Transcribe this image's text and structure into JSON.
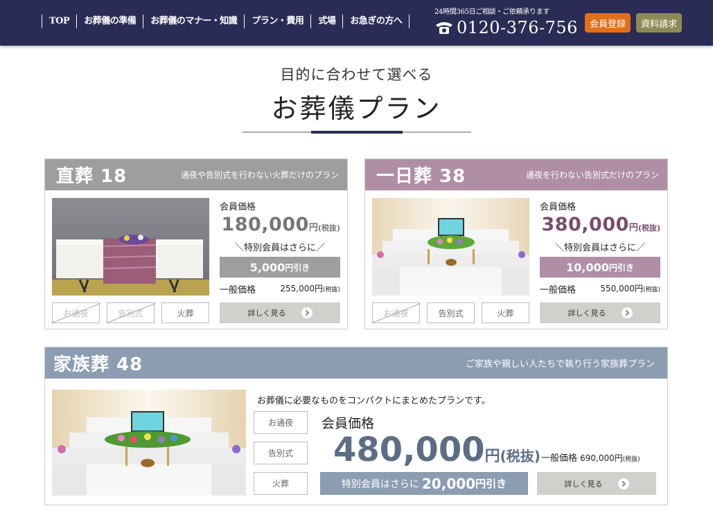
{
  "header": {
    "nav": [
      "TOP",
      "お葬儀の準備",
      "お葬儀のマナー・知識",
      "プラン・費用",
      "式場",
      "お急ぎの方へ"
    ],
    "contact_note": "24時間365日ご相談・ご依頼承ります",
    "phone": "0120-376-756",
    "member_button": "会員登録",
    "request_button": "資料請求"
  },
  "section": {
    "subtitle": "目的に合わせて選べる",
    "title": "お葬儀プラン"
  },
  "plans": [
    {
      "name": "直葬 18",
      "desc": "通夜や告別式を行わない火葬だけのプラン",
      "member_label": "会員価格",
      "price": "180,000",
      "unit": "円",
      "tax": "(税抜)",
      "special": "＼特別会員はさらに／",
      "discount": "5,000",
      "discount_suffix": "円引き",
      "general_label": "一般価格",
      "general_price": "255,000円",
      "general_tax": "(税抜)",
      "tags": [
        "お通夜",
        "告別式",
        "火葬"
      ],
      "detail": "詳しく見る",
      "color": "#9e9e9e"
    },
    {
      "name": "一日葬 38",
      "desc": "通夜を行わない告別式だけのプラン",
      "member_label": "会員価格",
      "price": "380,000",
      "unit": "円",
      "tax": "(税抜)",
      "special": "＼特別会員はさらに／",
      "discount": "10,000",
      "discount_suffix": "円引き",
      "general_label": "一般価格",
      "general_price": "550,000円",
      "general_tax": "(税抜)",
      "tags": [
        "お通夜",
        "告別式",
        "火葬"
      ],
      "detail": "詳しく見る",
      "color": "#b08ea6"
    },
    {
      "name": "家族葬 48",
      "desc": "ご家族や親しい人たちで執り行う家族葬プラン",
      "intro": "お葬儀に必要なものをコンパクトにまとめたプランです。",
      "member_label": "会員価格",
      "price": "480,000",
      "unit": "円",
      "tax": "(税抜)",
      "discount_prefix": "特別会員はさらに",
      "discount": "20,000",
      "discount_suffix": "円引き",
      "general_label": "一般価格",
      "general_price": "690,000円",
      "general_tax": "(税抜)",
      "tags": [
        "お通夜",
        "告別式",
        "火葬"
      ],
      "detail": "詳しく見る",
      "color": "#8c9db2"
    }
  ],
  "colors": {
    "header_bg": "#2a2c55",
    "member_button": "#e0701a",
    "request_button": "#8e8a55",
    "price_purple": "#7a4d6c",
    "price_blue": "#5e6d86"
  }
}
